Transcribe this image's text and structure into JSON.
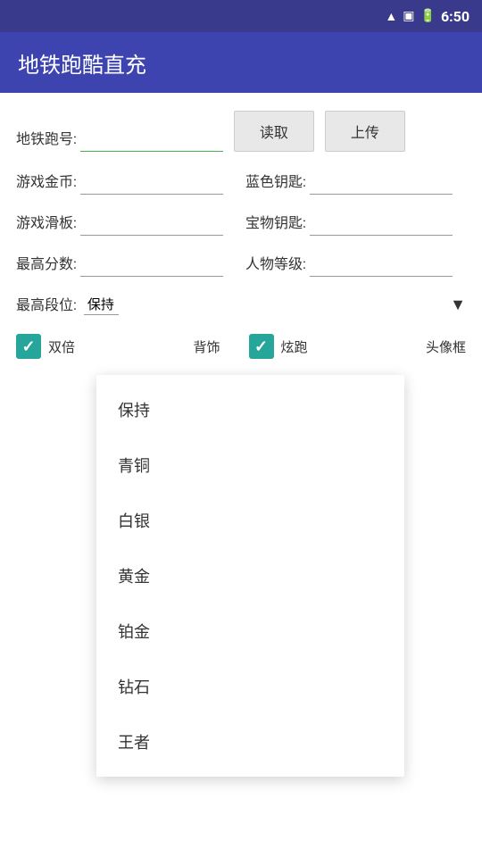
{
  "statusBar": {
    "time": "6:50"
  },
  "appBar": {
    "title": "地铁跑酷直充"
  },
  "form": {
    "field1Label": "地铁跑号:",
    "field1Value": "",
    "field1Placeholder": "",
    "readButton": "读取",
    "uploadButton": "上传",
    "field2Label": "游戏金币:",
    "field2Value": "",
    "field3Label": "蓝色钥匙:",
    "field3Value": "",
    "field4Label": "游戏滑板:",
    "field4Value": "",
    "field5Label": "宝物钥匙:",
    "field5Value": "",
    "field6Label": "最高分数:",
    "field6Value": "",
    "field7Label": "人物等级:",
    "field7Value": "",
    "field8Label": "最高段位:",
    "field8Value": "",
    "checkbox1Label": "双倍",
    "checkbox1Suffix": "背饰",
    "checkbox2Label": "炫跑",
    "checkbox2Suffix": "头像框"
  },
  "dropdown": {
    "arrowSymbol": "▼",
    "items": [
      {
        "label": "保持",
        "value": "keep"
      },
      {
        "label": "青铜",
        "value": "bronze"
      },
      {
        "label": "白银",
        "value": "silver"
      },
      {
        "label": "黄金",
        "value": "gold"
      },
      {
        "label": "铂金",
        "value": "platinum"
      },
      {
        "label": "钻石",
        "value": "diamond"
      },
      {
        "label": "王者",
        "value": "king"
      }
    ]
  }
}
